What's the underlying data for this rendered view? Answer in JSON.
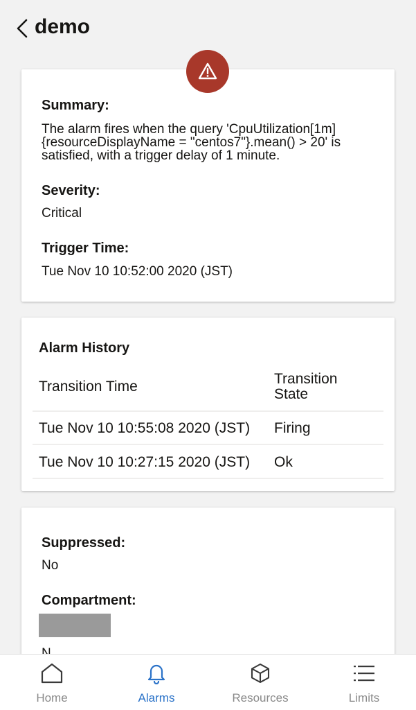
{
  "header": {
    "title": "demo",
    "back_icon": "chevron-left-icon"
  },
  "alert": {
    "icon": "warning-icon",
    "color": "#a8382a"
  },
  "summary": {
    "summary_label": "Summary:",
    "summary_lines": [
      "The alarm fires when the query 'CpuUtilization[1m]",
      "{resourceDisplayName = \"centos7\"}.mean() > 20' is",
      "satisfied, with a trigger delay of 1 minute."
    ],
    "severity_label": "Severity:",
    "severity_value": "Critical",
    "trigger_label": "Trigger Time:",
    "trigger_value": "Tue Nov 10 10:52:00 2020 (JST)"
  },
  "history": {
    "title": "Alarm History",
    "col_time": "Transition Time",
    "col_state_line1": "Transition",
    "col_state_line2": "State",
    "rows": [
      {
        "time": "Tue Nov 10 10:55:08 2020 (JST)",
        "state": "Firing"
      },
      {
        "time": "Tue Nov 10 10:27:15 2020 (JST)",
        "state": "Ok"
      }
    ]
  },
  "details": {
    "suppressed_label": "Suppressed:",
    "suppressed_value": "No",
    "compartment_label": "Compartment:",
    "partial_next_label": "N"
  },
  "bottom_nav": {
    "items": [
      {
        "label": "Home",
        "icon": "home-icon",
        "active": false
      },
      {
        "label": "Alarms",
        "icon": "bell-icon",
        "active": true
      },
      {
        "label": "Resources",
        "icon": "cube-icon",
        "active": false
      },
      {
        "label": "Limits",
        "icon": "list-icon",
        "active": false
      }
    ],
    "active_color": "#2a72c8",
    "inactive_color": "#8a8a8a"
  }
}
